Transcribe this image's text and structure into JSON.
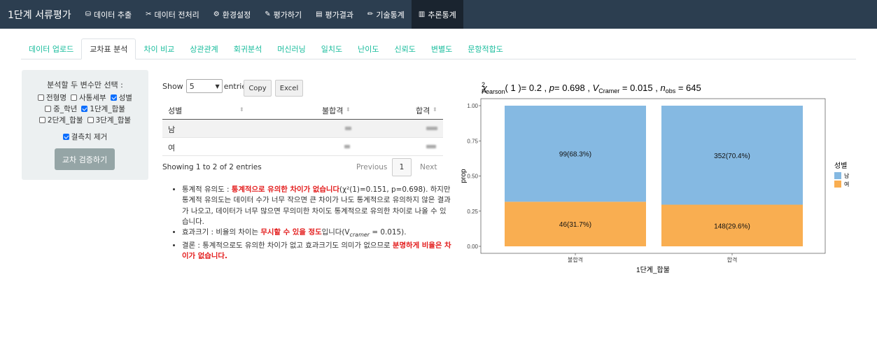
{
  "navbar": {
    "brand": "1단계 서류평가",
    "items": [
      {
        "label": "데이터 추출",
        "icon": "database-icon",
        "glyph": "⛁"
      },
      {
        "label": "데이터 전처리",
        "icon": "tools-icon",
        "glyph": "✂"
      },
      {
        "label": "환경설정",
        "icon": "cogs-icon",
        "glyph": "⚙"
      },
      {
        "label": "평가하기",
        "icon": "edit-icon",
        "glyph": "✎"
      },
      {
        "label": "평가결과",
        "icon": "file-icon",
        "glyph": "▤"
      },
      {
        "label": "기술통계",
        "icon": "pencil-icon",
        "glyph": "✏"
      },
      {
        "label": "추론통계",
        "icon": "chart-icon",
        "glyph": "▥"
      }
    ]
  },
  "tabs": [
    "데이터 업로드",
    "교차표 분석",
    "차이 비교",
    "상관관계",
    "회귀분석",
    "머신러닝",
    "일치도",
    "난이도",
    "신뢰도",
    "변별도",
    "문항적합도"
  ],
  "sidebar": {
    "title": "분석할 두 변수만 선택 :",
    "checkboxes": [
      {
        "label": "전형명",
        "checked": false
      },
      {
        "label": "사통세부",
        "checked": false
      },
      {
        "label": "성별",
        "checked": true
      },
      {
        "label": "중_학년",
        "checked": false
      },
      {
        "label": "1단계_합불",
        "checked": true
      },
      {
        "label": "2단계_합불",
        "checked": false
      },
      {
        "label": "3단계_합불",
        "checked": false
      }
    ],
    "missing_label": "결측치 제거",
    "missing_checked": true,
    "button": "교차 검증하기"
  },
  "datatable": {
    "show_label": "Show",
    "entries_value": "5",
    "entries_label": "entries",
    "copy_button": "Copy",
    "excel_button": "Excel",
    "columns": [
      "성별",
      "불합격",
      "합격"
    ],
    "rows": [
      {
        "name": "남"
      },
      {
        "name": "여"
      }
    ],
    "info": "Showing 1 to 2 of 2 entries",
    "prev": "Previous",
    "page": "1",
    "next": "Next"
  },
  "notes": {
    "n1_a": "통계적 유의도 : ",
    "n1_red": "통계적으로 유의한 차이가 없습니다",
    "n1_b": "(χ²(1)=0.151, p=0.698). 하지만 통계적 유의도는 데이터 수가 너무 작으면 큰 차이가 나도 통계적으로 유의하지 않은 결과가 나오고, 데이터가 너무 많으면 무의미한 차이도 통계적으로 유의한 차이로 나올 수 있습니다.",
    "n2_a": "효과크기 : 비율의 차이는 ",
    "n2_red": "무시할 수 있을 정도",
    "n2_b": "입니다(V",
    "n2_sub": "cramer",
    "n2_c": " = 0.015).",
    "n3_a": "결론 : 통계적으로도 유의한 차이가 없고 효과크기도 의미가 없으므로 ",
    "n3_red": "분명하게 비율은 차이가 없습니다."
  },
  "chart_data": {
    "type": "bar",
    "stacked": true,
    "subtitle": {
      "chi": "χ",
      "sup": "2",
      "pearson_sub": "Pearson",
      "df_text": "( 1 )= 0.2 , ",
      "p_italic": "p",
      "p_text": "= 0.698 , ",
      "v_italic": "V",
      "v_sub": "Cramer",
      "v_text": " = 0.015 , ",
      "n_italic": "n",
      "n_sub": "obs",
      "n_text": " = 645"
    },
    "categories": [
      "불합격",
      "합격"
    ],
    "series": [
      {
        "name": "남",
        "color": "#85b9e2",
        "values": [
          0.683,
          0.704
        ],
        "labels": [
          "99(68.3%)",
          "352(70.4%)"
        ]
      },
      {
        "name": "여",
        "color": "#f9ae51",
        "values": [
          0.317,
          0.296
        ],
        "labels": [
          "46(31.7%)",
          "148(29.6%)"
        ]
      }
    ],
    "xlabel": "1단계_합불",
    "ylabel": "prop",
    "ylim": [
      0,
      1
    ],
    "yticks": [
      "0.00",
      "0.25",
      "0.50",
      "0.75",
      "1.00"
    ],
    "legend_title": "성별",
    "legend_position": "right",
    "grid": false
  }
}
